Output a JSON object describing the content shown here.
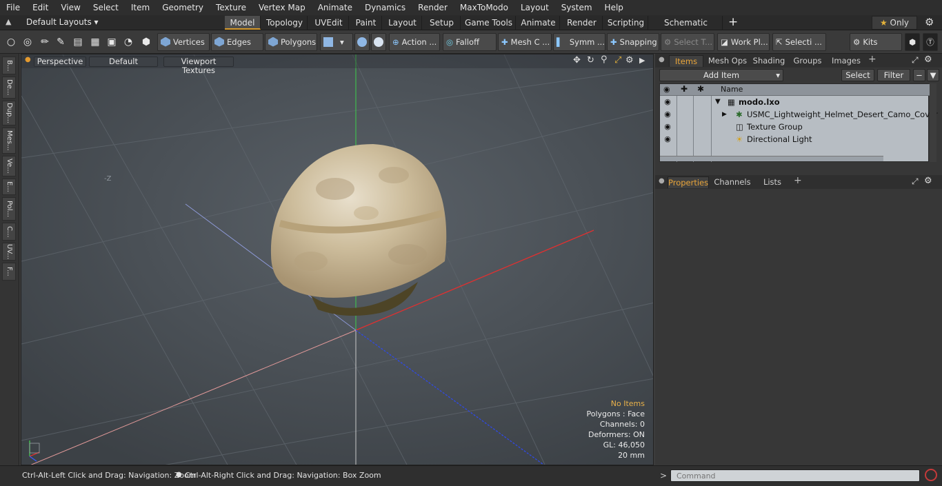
{
  "menu": [
    "File",
    "Edit",
    "View",
    "Select",
    "Item",
    "Geometry",
    "Texture",
    "Vertex Map",
    "Animate",
    "Dynamics",
    "Render",
    "MaxToModo",
    "Layout",
    "System",
    "Help"
  ],
  "layout_selector": "Default Layouts",
  "layout_tabs": [
    "Model",
    "Topology",
    "UVEdit",
    "Paint",
    "Layout",
    "Setup",
    "Game Tools",
    "Animate",
    "Render",
    "Scripting",
    "Schematic Fusion"
  ],
  "add_tab": "+",
  "only_label": "Only",
  "toolbar": {
    "vertices": "Vertices",
    "edges": "Edges",
    "polygons": "Polygons",
    "action": "Action",
    "falloff": "Falloff",
    "mesh": "Mesh C ...",
    "symm": "Symm ...",
    "snapping": "Snapping",
    "select_t": "Select T...",
    "work_pl": "Work Pl...",
    "selecti": "Selecti ...",
    "kits": "Kits"
  },
  "left_tabs": [
    "B...",
    "De...",
    "Dup...",
    "Mes...",
    "Ve...",
    "E...",
    "Pol...",
    "C...",
    "UV...",
    "F..."
  ],
  "viewport": {
    "perspective": "Perspective",
    "default": "Default",
    "textures": "Viewport Textures",
    "axis_label": "-Z",
    "hud": {
      "items": "No Items",
      "polygons": "Polygons : Face",
      "channels": "Channels: 0",
      "deformers": "Deformers: ON",
      "gl": "GL: 46,050",
      "scale": "20 mm"
    }
  },
  "items_panel": {
    "tabs": [
      "Items",
      "Mesh Ops",
      "Shading",
      "Groups",
      "Images"
    ],
    "add_item": "Add Item",
    "select": "Select",
    "filter": "Filter",
    "name_col": "Name",
    "rows": [
      {
        "label": "modo.lxo"
      },
      {
        "label": "USMC_Lightweight_Helmet_Desert_Camo_Cover"
      },
      {
        "label": "Texture Group"
      },
      {
        "label": "Directional Light"
      }
    ]
  },
  "properties_panel": {
    "tabs": [
      "Properties",
      "Channels",
      "Lists"
    ]
  },
  "status": {
    "left_text": "Ctrl-Alt-Left Click and Drag: Navigation: Zoom",
    "right_text": "Ctrl-Alt-Right Click and Drag: Navigation: Box Zoom"
  },
  "command": {
    "prompt": ">",
    "placeholder": "Command"
  }
}
